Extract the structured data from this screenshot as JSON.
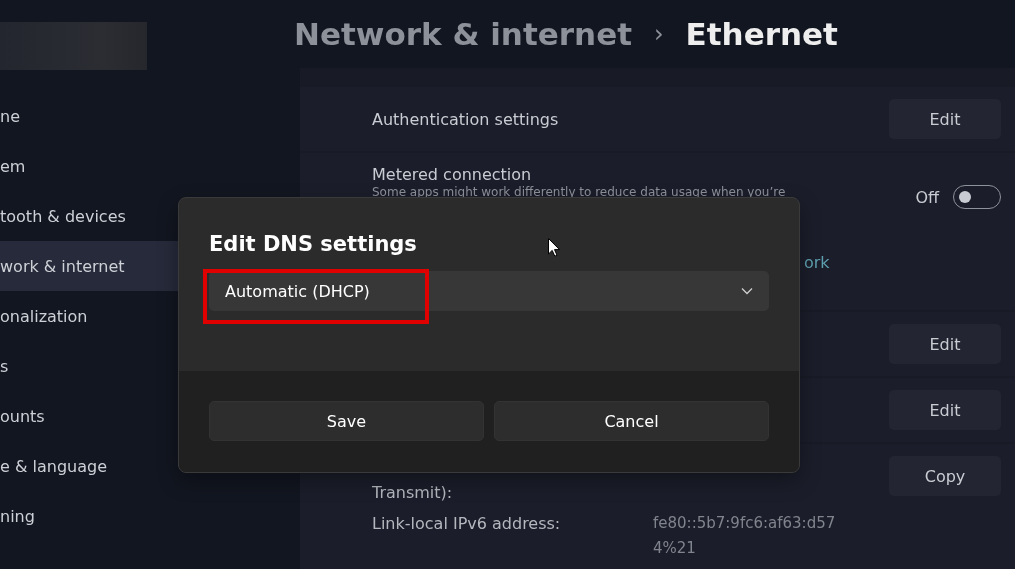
{
  "header": {
    "breadcrumb": "Network & internet",
    "separator": "›",
    "title": "Ethernet"
  },
  "sidebar": {
    "items": [
      {
        "label": "ne",
        "selected": false
      },
      {
        "label": "em",
        "selected": false
      },
      {
        "label": "tooth & devices",
        "selected": false
      },
      {
        "label": "work & internet",
        "selected": true
      },
      {
        "label": "onalization",
        "selected": false
      },
      {
        "label": "s",
        "selected": false
      },
      {
        "label": "ounts",
        "selected": false
      },
      {
        "label": "e & language",
        "selected": false
      },
      {
        "label": "ning",
        "selected": false
      }
    ]
  },
  "settings": [
    {
      "kind": "button",
      "label": "Authentication settings",
      "button": "Edit"
    },
    {
      "kind": "toggle",
      "label": "Metered connection",
      "description": "Some apps might work differently to reduce data usage when you’re",
      "state_label": "Off",
      "on": false,
      "link": "ork"
    },
    {
      "kind": "button",
      "button": "Edit"
    },
    {
      "kind": "button",
      "button": "Edit"
    },
    {
      "kind": "properties",
      "button": "Copy",
      "properties": [
        {
          "name": "Transmit):"
        },
        {
          "name": "Link-local IPv6 address:",
          "value": "fe80::5b7:9fc6:af63:d574%21"
        }
      ]
    }
  ],
  "dialog": {
    "title": "Edit DNS settings",
    "dropdown": {
      "value": "Automatic (DHCP)"
    },
    "buttons": [
      "Save",
      "Cancel"
    ]
  }
}
